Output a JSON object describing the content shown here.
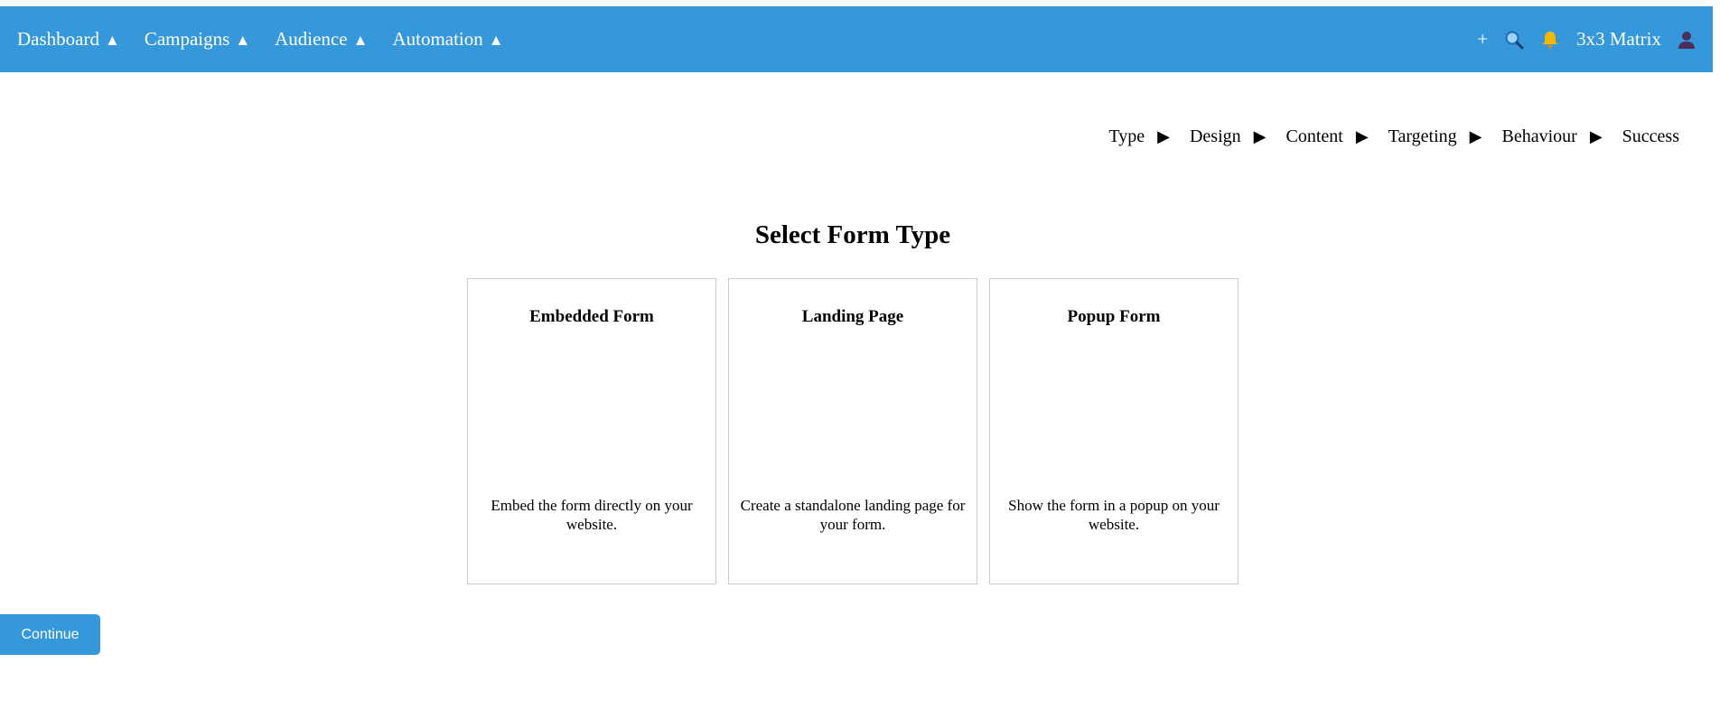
{
  "nav": {
    "items": [
      {
        "label": "Dashboard",
        "caret": "▲"
      },
      {
        "label": "Campaigns",
        "caret": "▲"
      },
      {
        "label": "Audience",
        "caret": "▲"
      },
      {
        "label": "Automation",
        "caret": "▲"
      }
    ],
    "right": {
      "plus": "+",
      "search_icon": "magnifier-icon",
      "bell_icon": "bell-icon",
      "account_name": "3x3 Matrix",
      "user_icon": "user-avatar-icon"
    }
  },
  "steps": {
    "arrow": "▶",
    "items": [
      "Type",
      "Design",
      "Content",
      "Targeting",
      "Behaviour",
      "Success"
    ]
  },
  "page": {
    "title": "Select Form Type"
  },
  "cards": [
    {
      "title": "Embedded Form",
      "description": "Embed the form directly on your website."
    },
    {
      "title": "Landing Page",
      "description": "Create a standalone landing page for your form."
    },
    {
      "title": "Popup Form",
      "description": "Show the form in a popup on your website."
    }
  ],
  "actions": {
    "continue_label": "Continue"
  },
  "colors": {
    "accent": "#3498db",
    "bell": "#f5b800",
    "search": "#1f6fbf",
    "avatar": "#4a2f5c"
  }
}
